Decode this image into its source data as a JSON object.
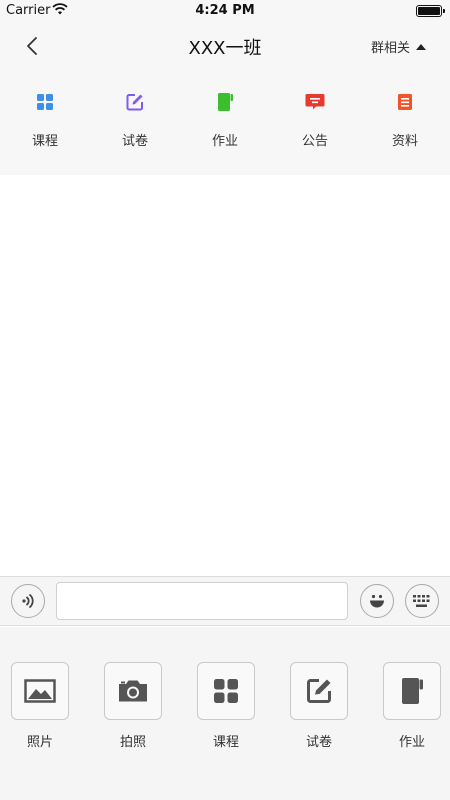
{
  "status_bar": {
    "carrier": "Carrier",
    "time": "4:24 PM",
    "battery_level": 1.0
  },
  "nav": {
    "title": "XXX一班",
    "group_menu_label": "群相关"
  },
  "quick_menu": [
    {
      "label": "课程",
      "icon": "grid-icon",
      "color": "#3d8fea"
    },
    {
      "label": "试卷",
      "icon": "edit-icon",
      "color": "#7d5cf0"
    },
    {
      "label": "作业",
      "icon": "notebook-icon",
      "color": "#3cbf2e"
    },
    {
      "label": "公告",
      "icon": "message-icon",
      "color": "#e8392e"
    },
    {
      "label": "资料",
      "icon": "document-icon",
      "color": "#f0542a"
    }
  ],
  "input_bar": {
    "message_value": ""
  },
  "tools": [
    {
      "label": "照片",
      "icon": "image-icon"
    },
    {
      "label": "拍照",
      "icon": "camera-icon"
    },
    {
      "label": "课程",
      "icon": "grid-icon"
    },
    {
      "label": "试卷",
      "icon": "edit-icon"
    },
    {
      "label": "作业",
      "icon": "notebook-icon"
    }
  ],
  "colors": {
    "icon_gray": "#555555",
    "bar_bg": "#f7f7f7"
  }
}
